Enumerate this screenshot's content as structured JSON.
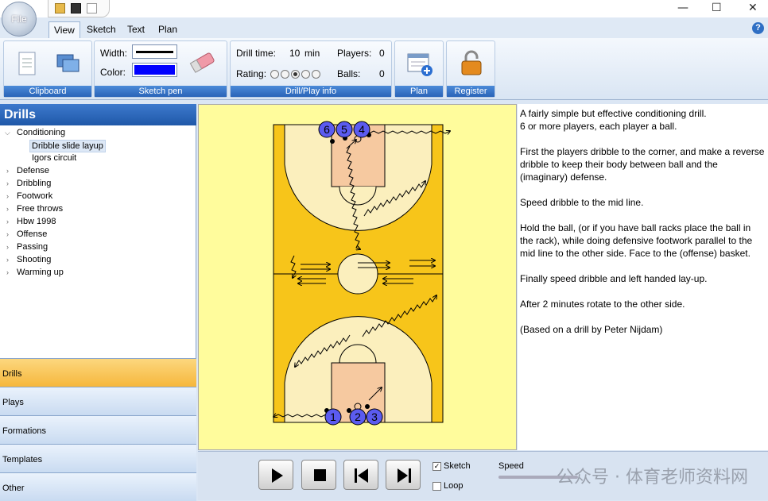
{
  "window": {
    "minimize": "—",
    "maximize": "☐",
    "close": "✕"
  },
  "file_button": {
    "label": "File"
  },
  "tabs": [
    {
      "label": "View"
    },
    {
      "label": "Sketch"
    },
    {
      "label": "Text"
    },
    {
      "label": "Plan"
    }
  ],
  "help": {
    "label": "?"
  },
  "ribbon": {
    "clipboard": {
      "label": "Clipboard"
    },
    "sketch_pen": {
      "label": "Sketch pen",
      "width_label": "Width:",
      "color_label": "Color:",
      "color": "#0000ff"
    },
    "info": {
      "label": "Drill/Play info",
      "drill_time_label": "Drill time:",
      "drill_time_value": "10",
      "drill_time_unit": "min",
      "players_label": "Players:",
      "players_value": "0",
      "rating_label": "Rating:",
      "balls_label": "Balls:",
      "balls_value": "0",
      "rating": {
        "selected": 3,
        "max": 5
      }
    },
    "plan": {
      "label": "Plan"
    },
    "register": {
      "label": "Register"
    }
  },
  "left": {
    "title": "Drills",
    "tree": [
      {
        "label": "Conditioning",
        "expanded": true,
        "children": [
          {
            "label": "Dribble slide layup",
            "selected": true
          },
          {
            "label": "Igors circuit"
          }
        ]
      },
      {
        "label": "Defense"
      },
      {
        "label": "Dribbling"
      },
      {
        "label": "Footwork"
      },
      {
        "label": "Free throws"
      },
      {
        "label": "Hbw 1998"
      },
      {
        "label": "Offense"
      },
      {
        "label": "Passing"
      },
      {
        "label": "Shooting"
      },
      {
        "label": "Warming up"
      }
    ],
    "nav": [
      {
        "label": "Drills"
      },
      {
        "label": "Plays"
      },
      {
        "label": "Formations"
      },
      {
        "label": "Templates"
      },
      {
        "label": "Other"
      }
    ]
  },
  "court": {
    "players_top": [
      "6",
      "5",
      "4"
    ],
    "players_bottom": [
      "1",
      "2",
      "3"
    ]
  },
  "description": [
    "A fairly simple but effective conditioning drill.\n6 or more players, each player a ball.",
    "First the players dribble to the corner, and make a reverse dribble to keep their body between ball and the (imaginary) defense.",
    "Speed dribble to the mid line.",
    "Hold the ball, (or if you have ball racks place the ball in the rack), while doing defensive footwork parallel to the mid line to the other side. Face to the (offense) basket.",
    "Finally speed dribble and left handed lay-up.",
    "After 2 minutes rotate to the other side.",
    "(Based on a drill by Peter Nijdam)"
  ],
  "playback": {
    "sketch_label": "Sketch",
    "sketch_checked": true,
    "loop_label": "Loop",
    "loop_checked": false,
    "speed_label": "Speed"
  },
  "watermark": {
    "text": "公众号 · 体育老师资料网"
  }
}
